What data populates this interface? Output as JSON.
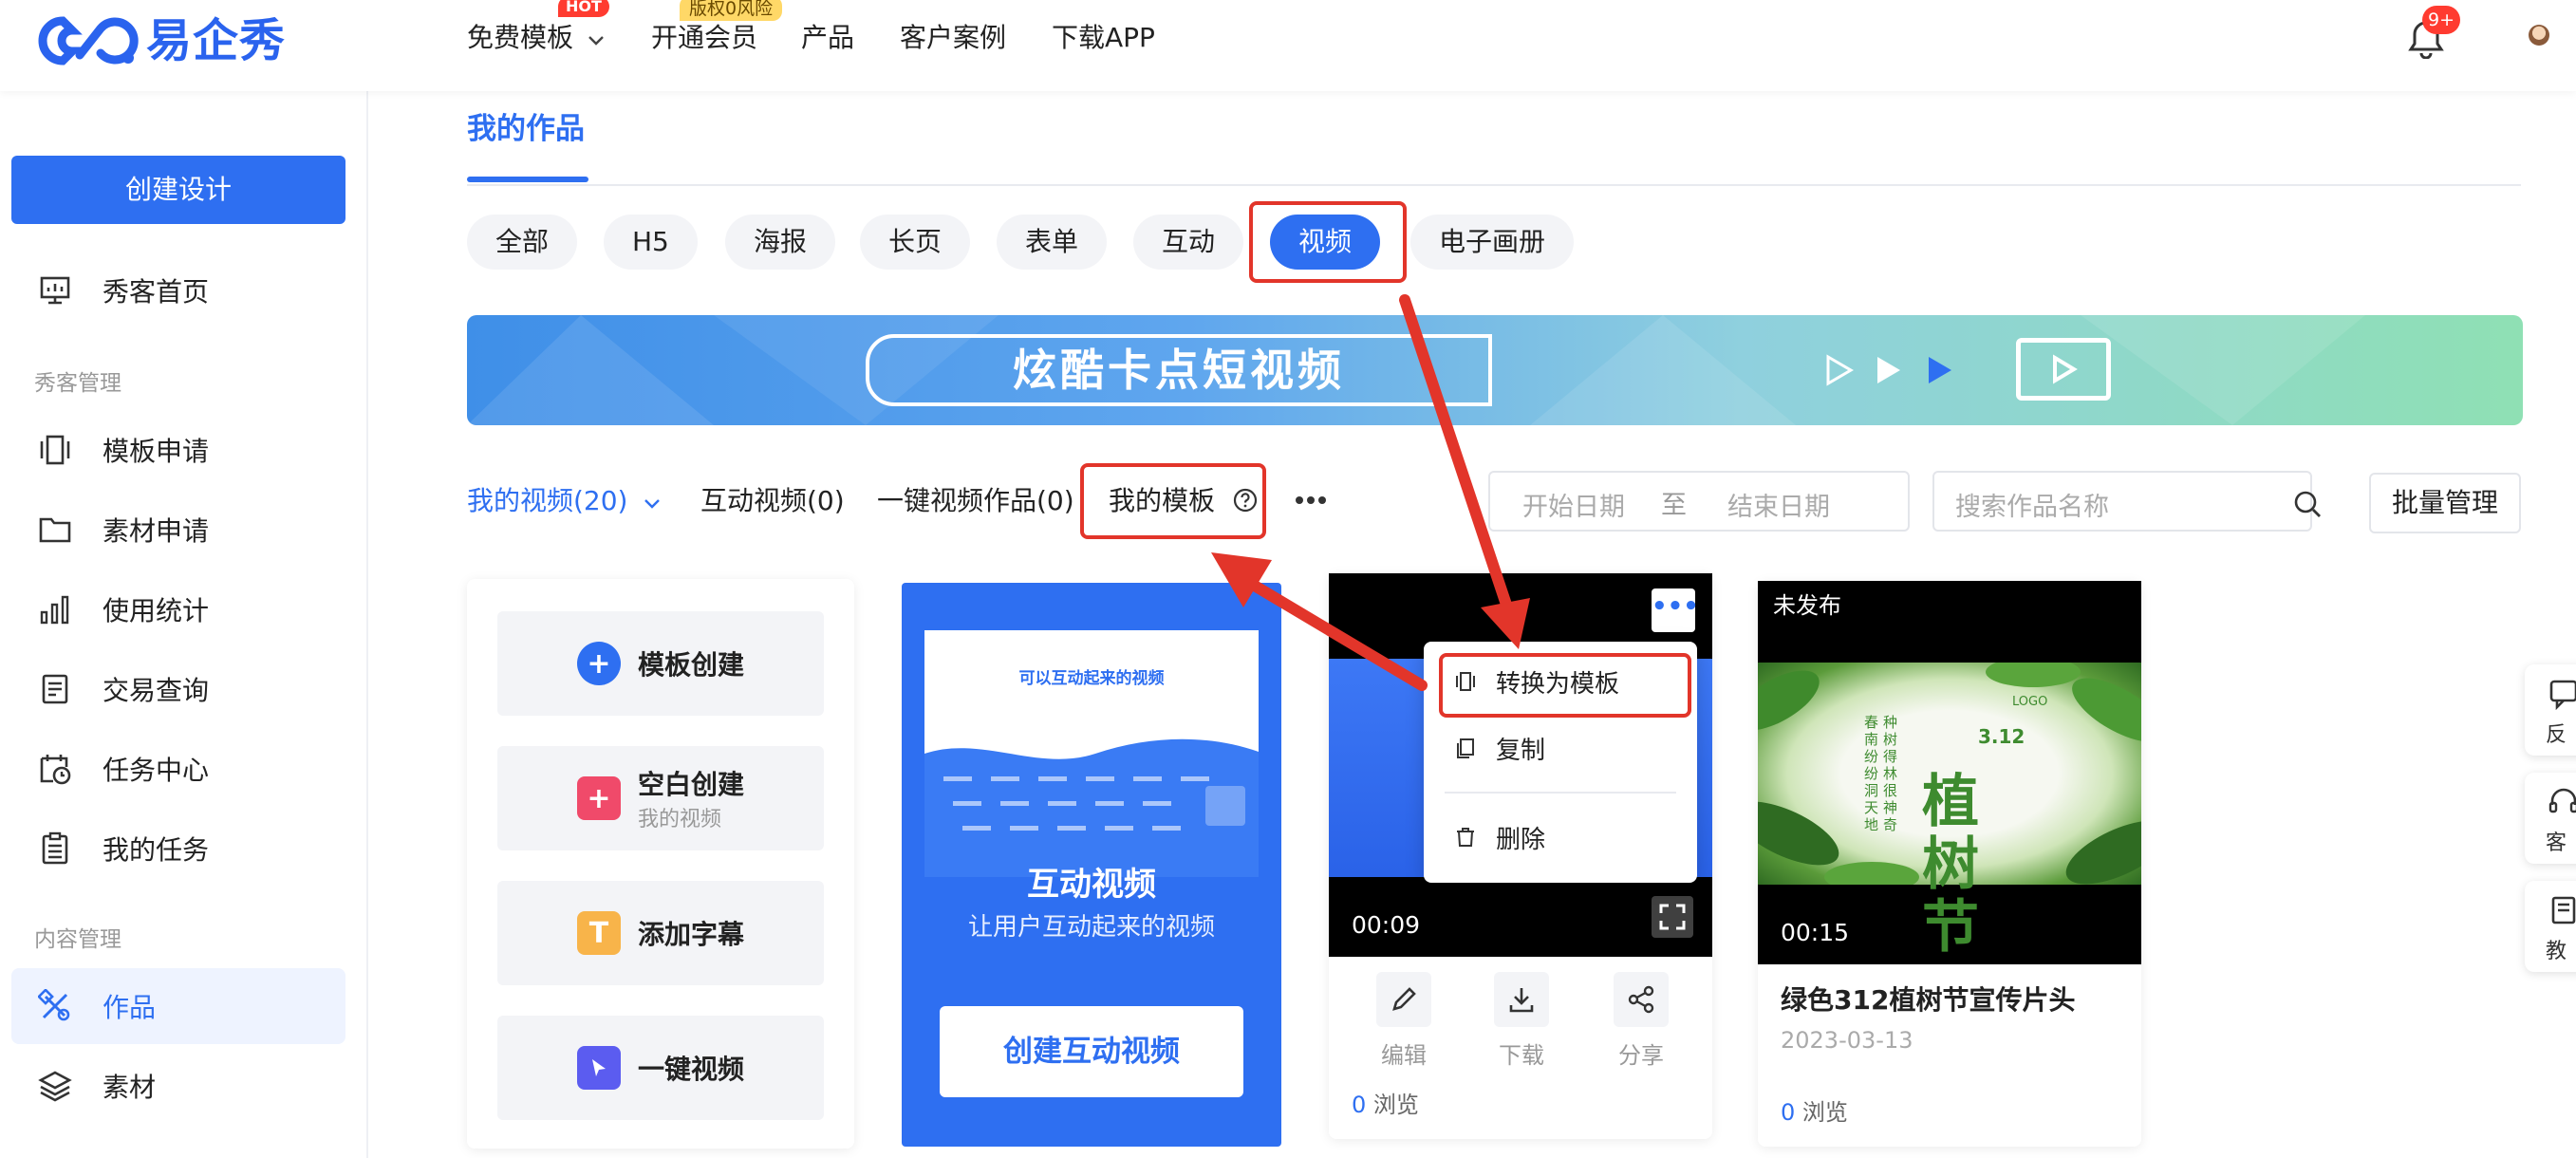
{
  "brand": {
    "name": "易企秀",
    "color": "#2a63ee"
  },
  "top_nav": {
    "items": [
      "免费模板",
      "开通会员",
      "产品",
      "客户案例",
      "下载APP"
    ],
    "hot_badge": "HOT",
    "copyright_badge": "版权0风险",
    "notification_count": "9+"
  },
  "sidebar": {
    "create_button": "创建设计",
    "home": "秀客首页",
    "group_xiuke": "秀客管理",
    "xiuke_items": [
      "模板申请",
      "素材申请",
      "使用统计",
      "交易查询",
      "任务中心",
      "我的任务"
    ],
    "group_content": "内容管理",
    "content_items": [
      "作品",
      "素材"
    ]
  },
  "page": {
    "title": "我的作品",
    "categories": [
      "全部",
      "H5",
      "海报",
      "长页",
      "表单",
      "互动",
      "视频",
      "电子画册"
    ],
    "active_category": "视频",
    "banner_title": "炫酷卡点短视频",
    "subtabs": [
      "我的视频(20)",
      "互动视频(0)",
      "一键视频作品(0)",
      "我的模板"
    ],
    "date_start_placeholder": "开始日期",
    "date_to": "至",
    "date_end_placeholder": "结束日期",
    "search_placeholder": "搜索作品名称",
    "batch_button": "批量管理"
  },
  "create_card": {
    "options": [
      {
        "label": "模板创建",
        "sub": ""
      },
      {
        "label": "空白创建",
        "sub": "我的视频"
      },
      {
        "label": "添加字幕",
        "sub": ""
      },
      {
        "label": "一键视频",
        "sub": ""
      }
    ]
  },
  "interactive_card": {
    "preview_title": "可以互动起来的视频",
    "title": "互动视频",
    "subtitle": "让用户互动起来的视频",
    "button": "创建互动视频"
  },
  "video_card": {
    "duration": "00:09",
    "actions": [
      "编辑",
      "下载",
      "分享"
    ],
    "views_count": "0",
    "views_label": "浏览",
    "menu": [
      "转换为模板",
      "复制",
      "删除"
    ]
  },
  "tree_card": {
    "status": "未发布",
    "duration": "00:15",
    "title": "绿色312植树节宣传片头",
    "date": "2023-03-13",
    "views_count": "0",
    "views_label": "浏览",
    "art_chars": [
      "植",
      "树",
      "节"
    ],
    "art_date": "3.12",
    "art_logo": "LOGO",
    "art_vertical": [
      "春",
      "南",
      "纷",
      "纷",
      "洞",
      "天",
      "地",
      "种",
      "树",
      "得",
      "林",
      "很",
      "神",
      "奇"
    ]
  },
  "float_tools": [
    "反",
    "客",
    "教"
  ],
  "colors": {
    "accent": "#2e6ff1",
    "highlight_red": "#e2352a",
    "hot_red": "#ff3b30",
    "badge_yellow": "#ffd867"
  }
}
